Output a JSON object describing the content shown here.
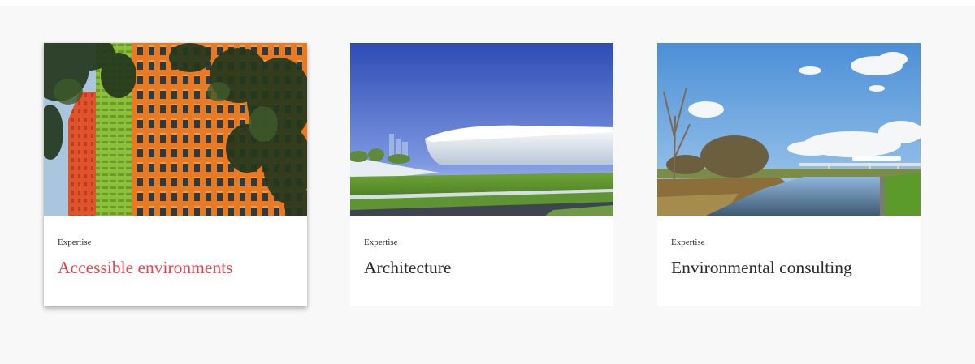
{
  "cards": [
    {
      "category": "Expertise",
      "title": "Accessible environments",
      "image": "colorful-office-facade-photo",
      "active": true
    },
    {
      "category": "Expertise",
      "title": "Architecture",
      "image": "white-stadium-architecture-photo",
      "active": false
    },
    {
      "category": "Expertise",
      "title": "Environmental consulting",
      "image": "river-bridge-landscape-photo",
      "active": false
    }
  ],
  "colors": {
    "page_background": "#f8f8f8",
    "card_background": "#ffffff",
    "title_text": "#2b2b2b",
    "active_title_text": "#e8434b",
    "category_text": "#333333"
  }
}
